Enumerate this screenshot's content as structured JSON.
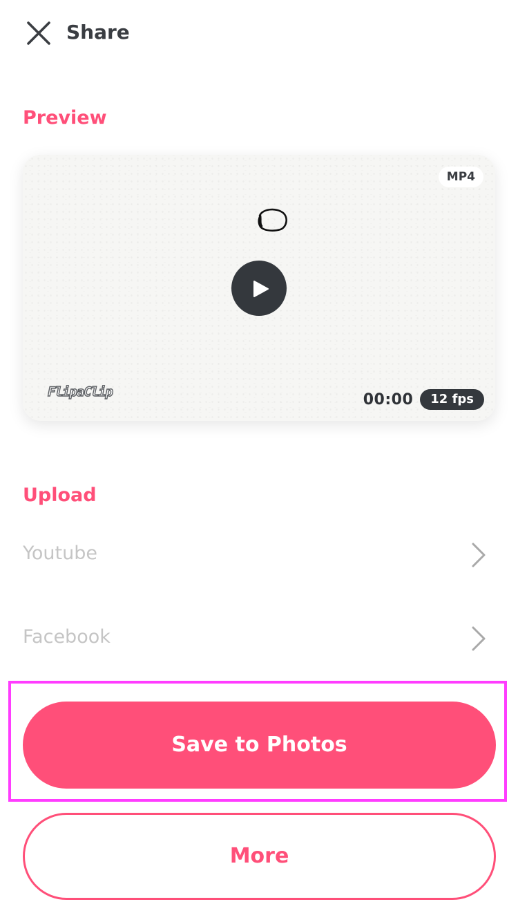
{
  "header": {
    "title": "Share",
    "close_icon": "close-icon"
  },
  "preview": {
    "section_label": "Preview",
    "format": "MP4",
    "logo_text": "FlipaClip",
    "timecode": "00:00",
    "fps": "12 fps",
    "play_icon": "play-icon"
  },
  "upload": {
    "section_label": "Upload",
    "items": [
      {
        "label": "Youtube",
        "icon": "chevron-right-icon"
      },
      {
        "label": "Facebook",
        "icon": "chevron-right-icon"
      }
    ]
  },
  "actions": {
    "save_label": "Save to Photos",
    "more_label": "More"
  },
  "colors": {
    "accent": "#ff4f79",
    "dark": "#34383d",
    "muted_text": "#c5c5c5",
    "highlight": "#ff3dff"
  }
}
